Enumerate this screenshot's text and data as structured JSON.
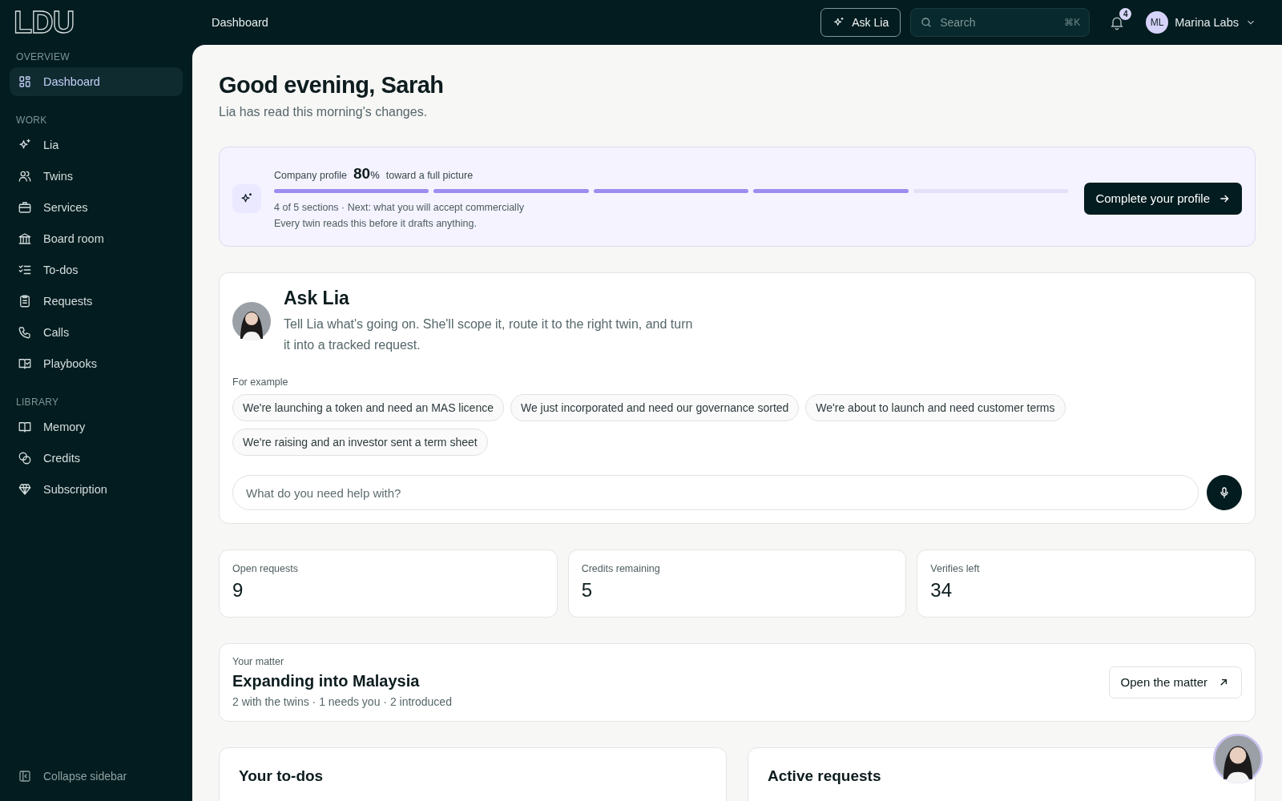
{
  "logo": "LDU",
  "sidebar": {
    "sections": [
      {
        "heading": "OVERVIEW",
        "items": [
          {
            "label": "Dashboard",
            "selected": true
          }
        ]
      },
      {
        "heading": "WORK",
        "items": [
          {
            "label": "Lia",
            "selected": false
          },
          {
            "label": "Twins",
            "selected": false
          },
          {
            "label": "Services",
            "selected": false
          },
          {
            "label": "Board room",
            "selected": false
          },
          {
            "label": "To-dos",
            "selected": false
          },
          {
            "label": "Requests",
            "selected": false
          },
          {
            "label": "Calls",
            "selected": false
          },
          {
            "label": "Playbooks",
            "selected": false
          }
        ]
      },
      {
        "heading": "LIBRARY",
        "items": [
          {
            "label": "Memory",
            "selected": false
          },
          {
            "label": "Credits",
            "selected": false
          },
          {
            "label": "Subscription",
            "selected": false
          }
        ]
      }
    ],
    "collapse": "Collapse sidebar"
  },
  "topbar": {
    "page": "Dashboard",
    "ask_button": "Ask Lia",
    "search": {
      "placeholder": "Search",
      "shortcut": "⌘K"
    },
    "notifications": "4",
    "account": {
      "initials": "ML",
      "name": "Marina Labs"
    }
  },
  "greeting": {
    "title": "Good evening, Sarah",
    "subtitle": "Lia has read this morning's changes."
  },
  "profile": {
    "label": "Company profile",
    "percent": "80",
    "percent_sign": "%",
    "caption": "toward a full picture",
    "sections": [
      {
        "done": true
      },
      {
        "done": true
      },
      {
        "done": true
      },
      {
        "done": true
      },
      {
        "done": false
      }
    ],
    "status": "4 of 5 sections · Next: what you will accept commercially",
    "note": "Every twin reads this before it drafts anything.",
    "button": "Complete your profile"
  },
  "ask": {
    "title": "Ask Lia",
    "description": "Tell Lia what's going on. She'll scope it, route it to the right twin, and turn it into a tracked request.",
    "examples_label": "For example",
    "examples": [
      "We're launching a token and need an MAS licence",
      "We just incorporated and need our governance sorted",
      "We're about to launch and need customer terms",
      "We're raising and an investor sent a term sheet"
    ],
    "input": {
      "placeholder": "What do you need help with?"
    }
  },
  "stats": [
    {
      "label": "Open requests",
      "value": "9"
    },
    {
      "label": "Credits remaining",
      "value": "5"
    },
    {
      "label": "Verifies left",
      "value": "34"
    }
  ],
  "matter": {
    "eyebrow": "Your matter",
    "title": "Expanding into Malaysia",
    "summary": "2 with the twins · 1 needs you · 2 introduced",
    "button": "Open the matter"
  },
  "panels": [
    {
      "title": "Your to-dos"
    },
    {
      "title": "Active requests"
    }
  ]
}
